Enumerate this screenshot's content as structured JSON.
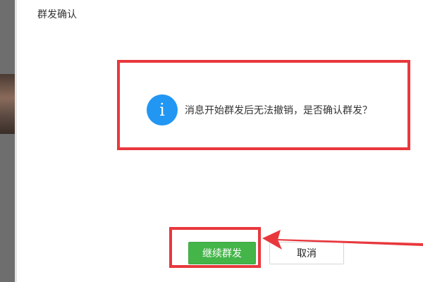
{
  "dialog": {
    "title": "群发确认",
    "message": "消息开始群发后无法撤销，是否确认群发？",
    "info_icon_glyph": "i",
    "continue_label": "继续群发",
    "cancel_label": "取消"
  },
  "colors": {
    "primary_button": "#44b549",
    "info_icon": "#2196f3",
    "annotation": "#e8383d"
  },
  "icons": [
    "info-icon"
  ]
}
